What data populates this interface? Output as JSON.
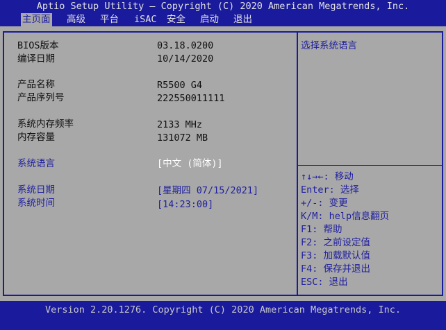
{
  "title_bar": "Aptio Setup Utility – Copyright (C) 2020 American Megatrends, Inc.",
  "tabs": [
    {
      "label": "主页面",
      "active": true
    },
    {
      "label": "高级",
      "active": false
    },
    {
      "label": "平台",
      "active": false
    },
    {
      "label": "iSAC",
      "active": false
    },
    {
      "label": "安全",
      "active": false
    },
    {
      "label": "启动",
      "active": false
    },
    {
      "label": "退出",
      "active": false
    }
  ],
  "info": {
    "bios_version_label": "BIOS版本",
    "bios_version_value": "03.18.0200",
    "build_date_label": "编译日期",
    "build_date_value": "10/14/2020",
    "product_name_label": "产品名称",
    "product_name_value": "R5500 G4",
    "serial_label": "产品序列号",
    "serial_value": "222550011111",
    "mem_freq_label": "系统内存频率",
    "mem_freq_value": "2133 MHz",
    "mem_size_label": "内存容量",
    "mem_size_value": "131072 MB"
  },
  "settings": {
    "language_label": "系统语言",
    "language_value": "[中文 (简体)]",
    "date_label": "系统日期",
    "date_value": "[星期四 07/15/2021]",
    "time_label": "系统时间",
    "time_value": "[14:23:00]"
  },
  "help_panel": {
    "description": "选择系统语言",
    "keys": [
      "↑↓→←: 移动",
      "Enter: 选择",
      "+/-: 变更",
      "K/M: help信息翻页",
      "F1: 帮助",
      "F2: 之前设定值",
      "F3: 加载默认值",
      "F4: 保存并退出",
      "ESC: 退出"
    ]
  },
  "footer": "Version 2.20.1276. Copyright (C) 2020 American Megatrends, Inc."
}
